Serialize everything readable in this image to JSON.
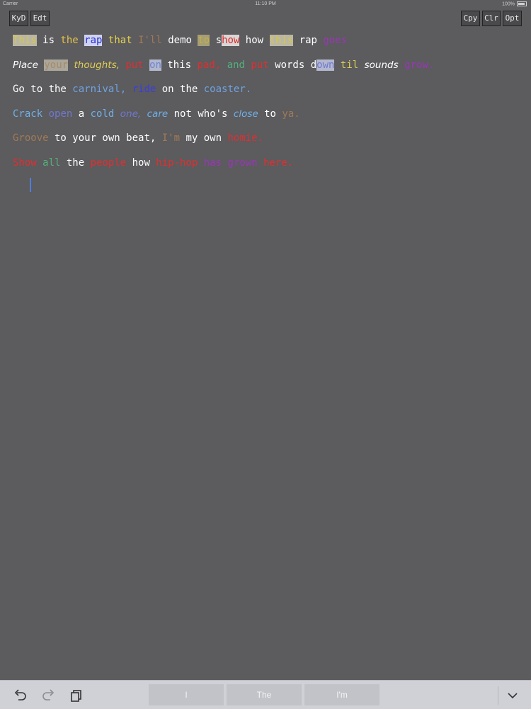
{
  "status_bar": {
    "carrier": "Carrier",
    "time": "11:10 PM",
    "battery": "100%"
  },
  "toolbar": {
    "left": [
      {
        "label": "KyD"
      },
      {
        "label": "Edt"
      }
    ],
    "right": [
      {
        "label": "Cpy"
      },
      {
        "label": "Clr"
      },
      {
        "label": "Opt"
      }
    ]
  },
  "lines": [
    [
      {
        "text": "This",
        "color": "#d8c64a",
        "bg": "#b9b7a4"
      },
      {
        "text": " is ",
        "color": "#ffffff"
      },
      {
        "text": "the",
        "color": "#e3c24a"
      },
      {
        "text": " ",
        "color": "#ffffff"
      },
      {
        "text": "rap",
        "color": "#2a2fd9",
        "bg": "#cfd3ef"
      },
      {
        "text": " ",
        "color": "#ffffff"
      },
      {
        "text": "that",
        "color": "#e7d44a"
      },
      {
        "text": " ",
        "color": "#ffffff"
      },
      {
        "text": "I'll",
        "color": "#a07a55"
      },
      {
        "text": " demo ",
        "color": "#ffffff"
      },
      {
        "text": "to",
        "color": "#c9b040",
        "bg": "#a59e76"
      },
      {
        "text": " s",
        "color": "#ffffff"
      },
      {
        "text": "how",
        "color": "#e12b2b",
        "bg": "#d9d6d6"
      },
      {
        "text": " how ",
        "color": "#ffffff"
      },
      {
        "text": "this",
        "color": "#d8c64a",
        "bg": "#b9b7a4"
      },
      {
        "text": " rap ",
        "color": "#ffffff"
      },
      {
        "text": "goes",
        "color": "#9a36b9"
      }
    ],
    [
      {
        "text": "Place",
        "color": "#ffffff",
        "italic": true
      },
      {
        "text": " ",
        "color": "#ffffff"
      },
      {
        "text": "your",
        "color": "#a98a66",
        "bg": "#aaa69a"
      },
      {
        "text": " ",
        "color": "#ffffff"
      },
      {
        "text": "thoughts,",
        "color": "#e0ce55",
        "italic": true
      },
      {
        "text": " ",
        "color": "#ffffff"
      },
      {
        "text": "put",
        "color": "#e02f2f"
      },
      {
        "text": " ",
        "color": "#ffffff"
      },
      {
        "text": "on",
        "color": "#6a85cf",
        "bg": "#b3b8cf"
      },
      {
        "text": " this ",
        "color": "#ffffff"
      },
      {
        "text": "pad,",
        "color": "#e02f2f"
      },
      {
        "text": " ",
        "color": "#ffffff"
      },
      {
        "text": "and",
        "color": "#55b07a"
      },
      {
        "text": " ",
        "color": "#ffffff"
      },
      {
        "text": "put",
        "color": "#e02f2f"
      },
      {
        "text": " words d",
        "color": "#ffffff"
      },
      {
        "text": "own",
        "color": "#6f78cf",
        "bg": "#b3b8cf"
      },
      {
        "text": " ",
        "color": "#ffffff"
      },
      {
        "text": "til",
        "color": "#e0ce55"
      },
      {
        "text": " ",
        "color": "#ffffff"
      },
      {
        "text": "sounds",
        "color": "#ffffff",
        "italic": true
      },
      {
        "text": " ",
        "color": "#ffffff"
      },
      {
        "text": "grow.",
        "color": "#9a36b9"
      }
    ],
    [
      {
        "text": "Go to the ",
        "color": "#ffffff"
      },
      {
        "text": "carnival,",
        "color": "#6fa3e0"
      },
      {
        "text": " ",
        "color": "#ffffff"
      },
      {
        "text": "ride",
        "color": "#3a3ee0"
      },
      {
        "text": " on the ",
        "color": "#ffffff"
      },
      {
        "text": "coaster.",
        "color": "#6fa3e0"
      }
    ],
    [
      {
        "text": "Crack",
        "color": "#6fb0e8"
      },
      {
        "text": " ",
        "color": "#ffffff"
      },
      {
        "text": "open",
        "color": "#6f78cf"
      },
      {
        "text": " a ",
        "color": "#ffffff"
      },
      {
        "text": "cold",
        "color": "#6fb0e8"
      },
      {
        "text": " ",
        "color": "#ffffff"
      },
      {
        "text": "one,",
        "color": "#6f78cf",
        "italic": true
      },
      {
        "text": " ",
        "color": "#ffffff"
      },
      {
        "text": "care",
        "color": "#6fb0e8",
        "italic": true
      },
      {
        "text": " not who's ",
        "color": "#ffffff"
      },
      {
        "text": "close",
        "color": "#6fb0e8",
        "italic": true
      },
      {
        "text": " to ",
        "color": "#ffffff"
      },
      {
        "text": "ya.",
        "color": "#a07a55"
      }
    ],
    [
      {
        "text": "Groove",
        "color": "#a07a55"
      },
      {
        "text": " to your own beat, ",
        "color": "#ffffff"
      },
      {
        "text": "I'm",
        "color": "#a07a55"
      },
      {
        "text": " my own ",
        "color": "#ffffff"
      },
      {
        "text": "homie.",
        "color": "#e02f2f"
      }
    ],
    [
      {
        "text": "Show",
        "color": "#e02f2f"
      },
      {
        "text": " ",
        "color": "#ffffff"
      },
      {
        "text": "all",
        "color": "#55b07a"
      },
      {
        "text": " the ",
        "color": "#ffffff"
      },
      {
        "text": "people",
        "color": "#e02f2f"
      },
      {
        "text": " how ",
        "color": "#ffffff"
      },
      {
        "text": "hip-hop",
        "color": "#e02f2f"
      },
      {
        "text": " ",
        "color": "#ffffff"
      },
      {
        "text": "has",
        "color": "#9a36b9"
      },
      {
        "text": " ",
        "color": "#ffffff"
      },
      {
        "text": "grown",
        "color": "#9a36b9"
      },
      {
        "text": " ",
        "color": "#ffffff"
      },
      {
        "text": "here.",
        "color": "#e02f2f"
      }
    ]
  ],
  "suggestions": [
    "I",
    "The",
    "I'm"
  ],
  "bottom_icons": [
    "undo-icon",
    "redo-icon",
    "paste-icon",
    "hide-keyboard-icon"
  ]
}
